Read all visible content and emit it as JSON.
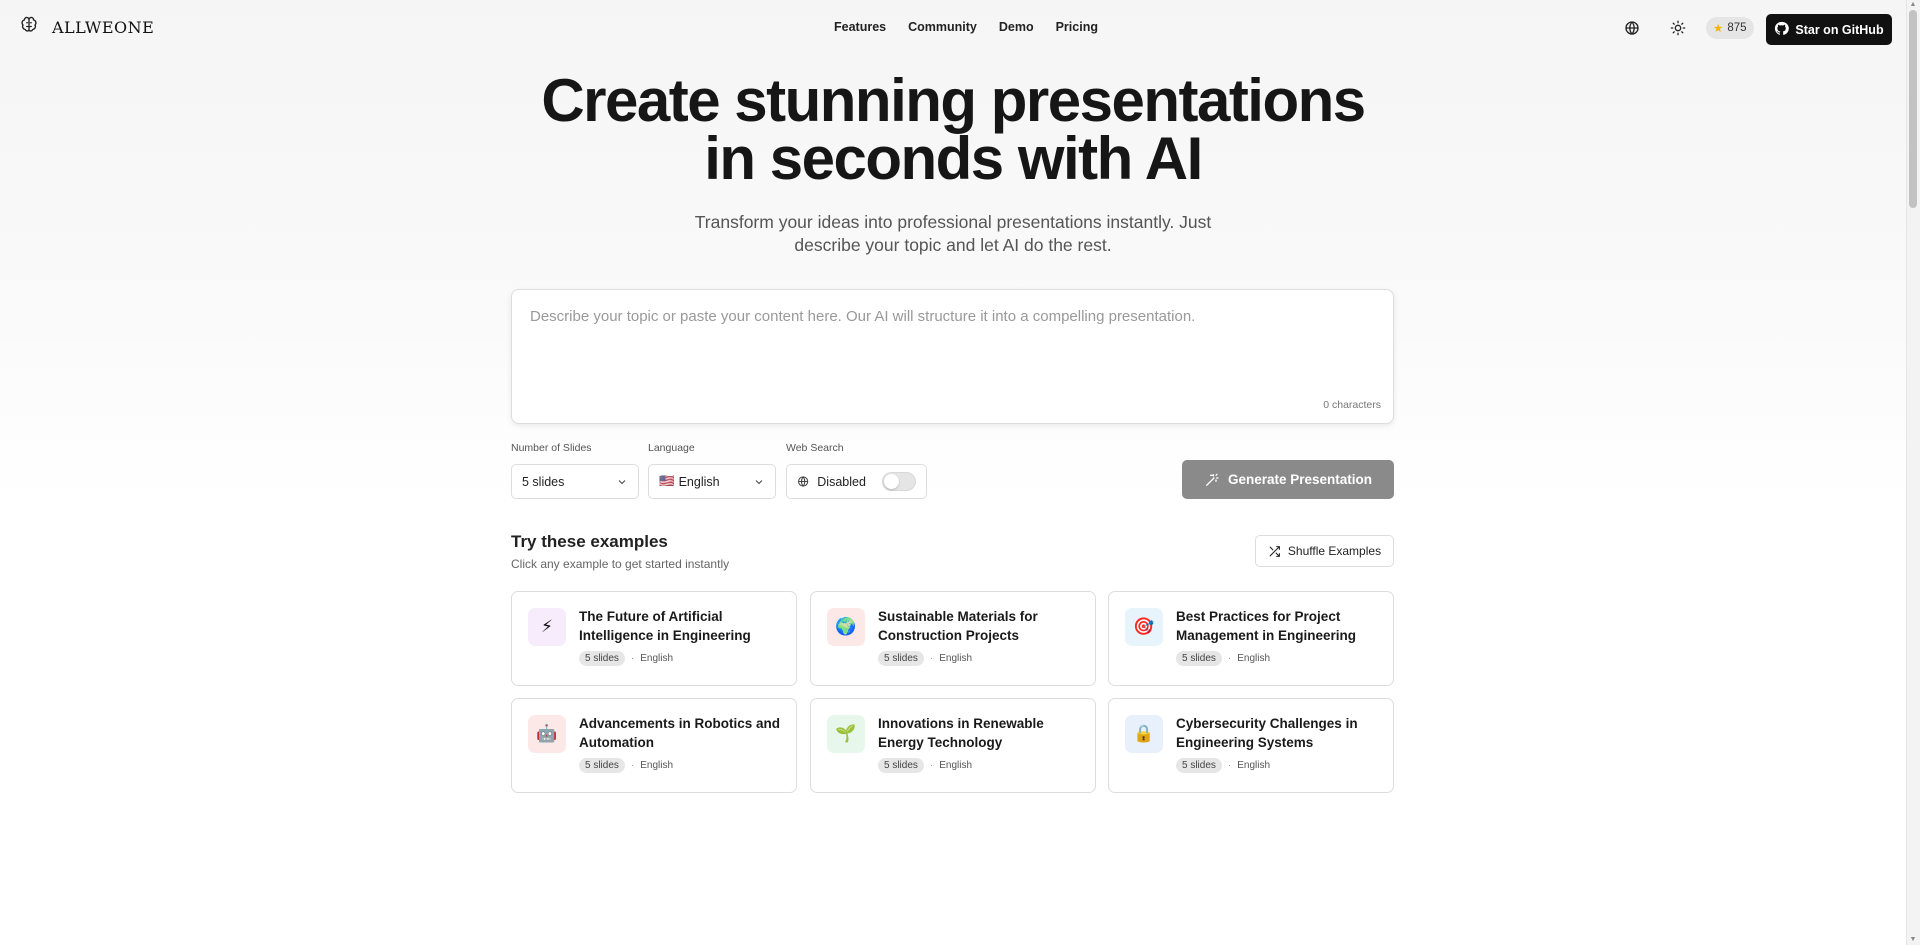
{
  "header": {
    "brand": "ALLWEONE",
    "nav": [
      "Features",
      "Community",
      "Demo",
      "Pricing"
    ],
    "stars": "875",
    "github_label": "Star on GitHub"
  },
  "hero": {
    "title_line1": "Create stunning presentations",
    "title_line2": "in seconds with AI",
    "subtitle": "Transform your ideas into professional presentations instantly. Just describe your topic and let AI do the rest."
  },
  "prompt": {
    "placeholder": "Describe your topic or paste your content here. Our AI will structure it into a compelling presentation.",
    "value": "",
    "char_count": "0 characters"
  },
  "controls": {
    "slides_label": "Number of Slides",
    "slides_value": "5 slides",
    "language_label": "Language",
    "language_flag": "🇺🇸",
    "language_value": "English",
    "websearch_label": "Web Search",
    "websearch_value": "Disabled",
    "websearch_enabled": false,
    "generate_label": "Generate Presentation"
  },
  "examples": {
    "title": "Try these examples",
    "subtitle": "Click any example to get started instantly",
    "shuffle_label": "Shuffle Examples",
    "items": [
      {
        "icon": "⚡",
        "title": "The Future of Artificial Intelligence in Engineering",
        "slides": "5 slides",
        "language": "English",
        "color": "#f6ecfb"
      },
      {
        "icon": "🌍",
        "title": "Sustainable Materials for Construction Projects",
        "slides": "5 slides",
        "language": "English",
        "color": "#fde8e8"
      },
      {
        "icon": "🎯",
        "title": "Best Practices for Project Management in Engineering",
        "slides": "5 slides",
        "language": "English",
        "color": "#e8f4fb"
      },
      {
        "icon": "🤖",
        "title": "Advancements in Robotics and Automation",
        "slides": "5 slides",
        "language": "English",
        "color": "#fde8e8"
      },
      {
        "icon": "🌱",
        "title": "Innovations in Renewable Energy Technology",
        "slides": "5 slides",
        "language": "English",
        "color": "#e8f7ec"
      },
      {
        "icon": "🔒",
        "title": "Cybersecurity Challenges in Engineering Systems",
        "slides": "5 slides",
        "language": "English",
        "color": "#e8f0fb"
      }
    ]
  }
}
